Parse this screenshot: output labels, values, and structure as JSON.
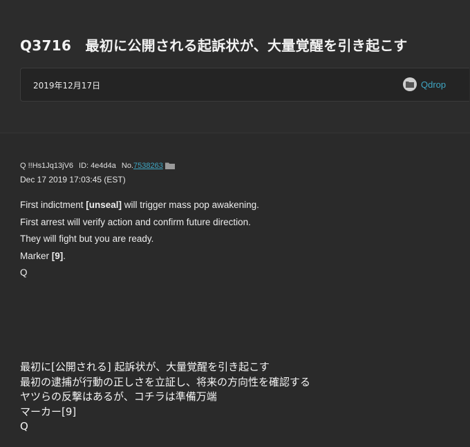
{
  "header": {
    "title": "Q3716　最初に公開される起訴状が、大量覚醒を引き起こす",
    "date": "2019年12月17日",
    "category": "Qdrop"
  },
  "post": {
    "author": "Q !!Hs1Jq13jV6",
    "id_label": "ID: 4e4d4a",
    "no_prefix": "No.",
    "no_value": "7538263",
    "timestamp": "Dec 17 2019 17:03:45 (EST)",
    "lines": [
      {
        "pre": "First indictment ",
        "bold": "[unseal]",
        "post": " will trigger mass pop awakening."
      },
      {
        "pre": "First arrest will verify action and confirm future direction.",
        "bold": "",
        "post": ""
      },
      {
        "pre": "They will fight but you are ready.",
        "bold": "",
        "post": ""
      },
      {
        "pre": "Marker ",
        "bold": "[9]",
        "post": "."
      },
      {
        "pre": "Q",
        "bold": "",
        "post": ""
      }
    ]
  },
  "translation": {
    "lines": [
      "最初に[公開される] 起訴状が、大量覚醒を引き起こす",
      "最初の逮捕が行動の正しさを立証し、将来の方向性を確認する",
      "ヤツらの反撃はあるが、コチラは準備万端",
      "マーカー[9]",
      "Q"
    ]
  },
  "colors": {
    "background": "#2a2a2a",
    "link": "#3fa7c4",
    "text": "#e6e6e6"
  },
  "icons": {
    "category": "folder-icon",
    "post_folder": "folder-icon"
  }
}
